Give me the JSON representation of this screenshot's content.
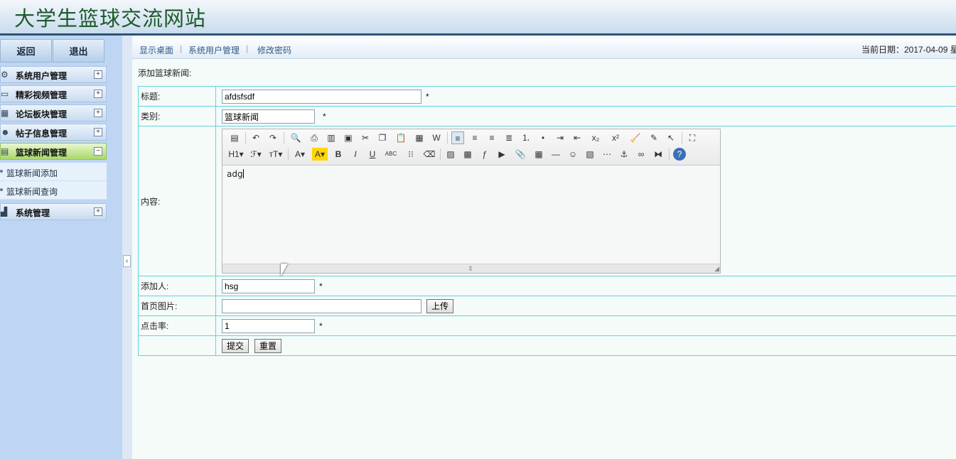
{
  "header": {
    "site_title": "大学生篮球交流网站"
  },
  "sidebar": {
    "back_label": "返回",
    "logout_label": "退出",
    "menu": [
      {
        "label": "系统用户管理",
        "icon": "gear-icon",
        "toggle": "+"
      },
      {
        "label": "精彩视频管理",
        "icon": "monitor-icon",
        "toggle": "+"
      },
      {
        "label": "论坛板块管理",
        "icon": "grid-icon",
        "toggle": "+"
      },
      {
        "label": "帖子信息管理",
        "icon": "user-icon",
        "toggle": "+"
      },
      {
        "label": "篮球新闻管理",
        "icon": "calendar-icon",
        "toggle": "−"
      },
      {
        "label": "系统管理",
        "icon": "chart-icon",
        "toggle": "+"
      }
    ],
    "submenu": [
      {
        "label": "篮球新闻添加"
      },
      {
        "label": "篮球新闻查询"
      }
    ],
    "collapse_glyph": "‹"
  },
  "topnav": {
    "links": [
      "显示桌面",
      "系统用户管理",
      "修改密码"
    ],
    "separator": "|",
    "date_text": "当前日期：2017-04-09 星"
  },
  "page": {
    "section_title": "添加篮球新闻:",
    "required_mark": "*",
    "fields": {
      "title": {
        "label": "标题:",
        "value": "afdsfsdf"
      },
      "category": {
        "label": "类别:",
        "value": "篮球新闻"
      },
      "content": {
        "label": "内容:",
        "value": "adg"
      },
      "author": {
        "label": "添加人:",
        "value": "hsg"
      },
      "image": {
        "label": "首页图片:",
        "value": "",
        "upload_label": "上传"
      },
      "hits": {
        "label": "点击率:",
        "value": "1"
      }
    },
    "submit_label": "提交",
    "reset_label": "重置"
  },
  "editor": {
    "row1": [
      "source-icon",
      "sep",
      "undo-icon",
      "redo-icon",
      "sep",
      "preview-icon",
      "print-icon",
      "template-icon",
      "select-all-icon",
      "cut-icon",
      "copy-icon",
      "paste-icon",
      "paste-text-icon",
      "paste-word-icon",
      "sep",
      "align-left-icon",
      "align-center-icon",
      "align-right-icon",
      "align-justify-icon",
      "ordered-list-icon",
      "unordered-list-icon",
      "indent-icon",
      "outdent-icon",
      "subscript-icon",
      "superscript-icon",
      "clear-format-icon",
      "select-icon",
      "cursor-icon",
      "sep",
      "fullscreen-icon"
    ],
    "row2": [
      "heading-icon",
      "font-family-icon",
      "font-size-icon",
      "sep",
      "font-color-icon",
      "highlight-icon",
      "bold-icon",
      "italic-icon",
      "underline-icon",
      "strikethrough-icon",
      "line-height-icon",
      "eraser-icon",
      "sep",
      "image-icon",
      "multi-image-icon",
      "flash-icon",
      "media-icon",
      "attachment-icon",
      "table-icon",
      "hr-icon",
      "emoticon-icon",
      "map-icon",
      "pagebreak-icon",
      "anchor-icon",
      "link-icon",
      "unlink-icon",
      "sep",
      "help-icon"
    ],
    "glyphs": {
      "source-icon": "▤",
      "undo-icon": "↶",
      "redo-icon": "↷",
      "preview-icon": "🔍",
      "print-icon": "⎙",
      "template-icon": "▥",
      "select-all-icon": "▣",
      "cut-icon": "✂",
      "copy-icon": "❐",
      "paste-icon": "📋",
      "paste-text-icon": "▦",
      "paste-word-icon": "W",
      "align-left-icon": "≡",
      "align-center-icon": "≡",
      "align-right-icon": "≡",
      "align-justify-icon": "≣",
      "ordered-list-icon": "⒈",
      "unordered-list-icon": "•",
      "indent-icon": "⇥",
      "outdent-icon": "⇤",
      "subscript-icon": "x₂",
      "superscript-icon": "x²",
      "clear-format-icon": "🧹",
      "select-icon": "✎",
      "cursor-icon": "↖",
      "fullscreen-icon": "⛶",
      "heading-icon": "H1▾",
      "font-family-icon": "ℱ▾",
      "font-size-icon": "ᴛT▾",
      "font-color-icon": "A▾",
      "highlight-icon": "A▾",
      "bold-icon": "B",
      "italic-icon": "I",
      "underline-icon": "U",
      "strikethrough-icon": "ABC",
      "line-height-icon": "⁝⁝",
      "eraser-icon": "⌫",
      "image-icon": "▨",
      "multi-image-icon": "▩",
      "flash-icon": "ƒ",
      "media-icon": "▶",
      "attachment-icon": "📎",
      "table-icon": "▦",
      "hr-icon": "―",
      "emoticon-icon": "☺",
      "map-icon": "▧",
      "pagebreak-icon": "⋯",
      "anchor-icon": "⚓",
      "link-icon": "∞",
      "unlink-icon": "⧓",
      "help-icon": "?"
    }
  }
}
